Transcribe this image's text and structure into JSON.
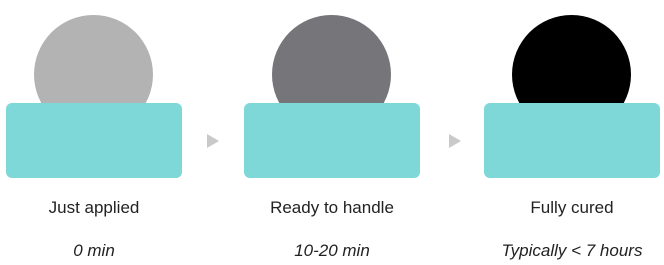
{
  "colors": {
    "block": "#7ed8d8",
    "arrow": "#c9c9c9",
    "text": "#222222"
  },
  "stages": [
    {
      "label": "Just applied",
      "time": "0 min",
      "circle_color": "#b3b3b3"
    },
    {
      "label": "Ready to handle",
      "time": "10-20 min",
      "circle_color": "#76767a"
    },
    {
      "label": "Fully cured",
      "time": "Typically < 7 hours",
      "circle_color": "#000000"
    }
  ]
}
